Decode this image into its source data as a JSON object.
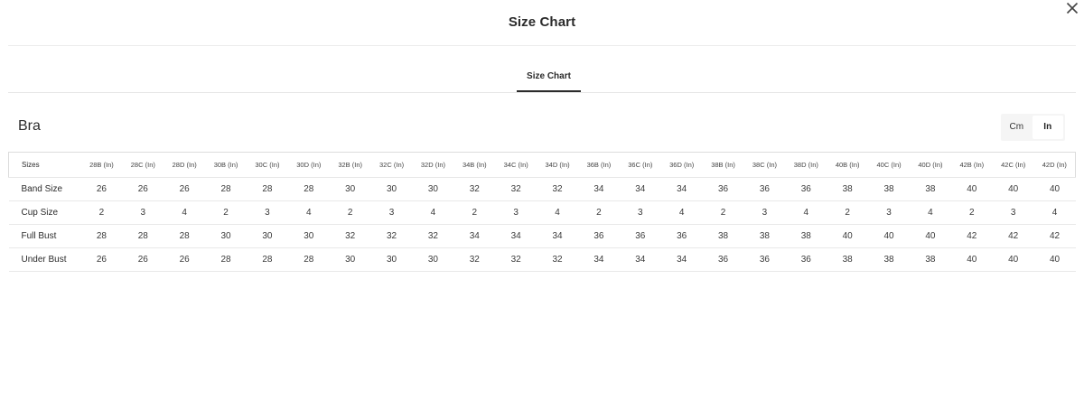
{
  "modal": {
    "title": "Size Chart"
  },
  "tabs": [
    {
      "label": "Size Chart"
    }
  ],
  "section": {
    "title": "Bra"
  },
  "unit_toggle": {
    "options": [
      "Cm",
      "In"
    ],
    "selected": "In"
  },
  "table": {
    "header_label": "Sizes",
    "columns": [
      "28B (In)",
      "28C (In)",
      "28D (In)",
      "30B (In)",
      "30C (In)",
      "30D (In)",
      "32B (In)",
      "32C (In)",
      "32D (In)",
      "34B (In)",
      "34C (In)",
      "34D (In)",
      "36B (In)",
      "36C (In)",
      "36D (In)",
      "38B (In)",
      "38C (In)",
      "38D (In)",
      "40B (In)",
      "40C (In)",
      "40D (In)",
      "42B (In)",
      "42C (In)",
      "42D (In)"
    ],
    "rows": [
      {
        "label": "Band Size",
        "values": [
          "26",
          "26",
          "26",
          "28",
          "28",
          "28",
          "30",
          "30",
          "30",
          "32",
          "32",
          "32",
          "34",
          "34",
          "34",
          "36",
          "36",
          "36",
          "38",
          "38",
          "38",
          "40",
          "40",
          "40"
        ]
      },
      {
        "label": "Cup Size",
        "values": [
          "2",
          "3",
          "4",
          "2",
          "3",
          "4",
          "2",
          "3",
          "4",
          "2",
          "3",
          "4",
          "2",
          "3",
          "4",
          "2",
          "3",
          "4",
          "2",
          "3",
          "4",
          "2",
          "3",
          "4"
        ]
      },
      {
        "label": "Full Bust",
        "values": [
          "28",
          "28",
          "28",
          "30",
          "30",
          "30",
          "32",
          "32",
          "32",
          "34",
          "34",
          "34",
          "36",
          "36",
          "36",
          "38",
          "38",
          "38",
          "40",
          "40",
          "40",
          "42",
          "42",
          "42"
        ]
      },
      {
        "label": "Under Bust",
        "values": [
          "26",
          "26",
          "26",
          "28",
          "28",
          "28",
          "30",
          "30",
          "30",
          "32",
          "32",
          "32",
          "34",
          "34",
          "34",
          "36",
          "36",
          "36",
          "38",
          "38",
          "38",
          "40",
          "40",
          "40"
        ]
      }
    ]
  }
}
